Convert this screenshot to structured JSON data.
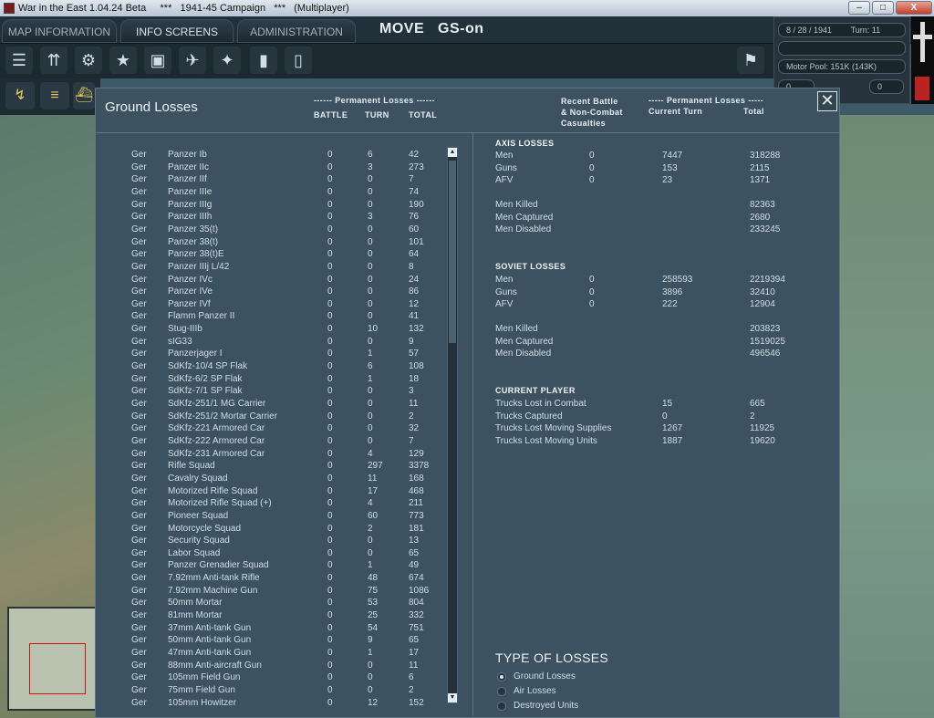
{
  "window": {
    "title": "War in the East 1.04.24 Beta     ***   1941-45 Campaign   ***   (Multiplayer)",
    "min": "–",
    "max": "□",
    "close": "X"
  },
  "topbar": {
    "tabs": [
      "MAP INFORMATION",
      "INFO SCREENS",
      "ADMINISTRATION"
    ],
    "mode": "MOVE",
    "gs": "GS-on"
  },
  "infopanel": {
    "date": "8 / 28 / 1941",
    "turn": "Turn: 11",
    "motor_pool": "Motor Pool: 151K (143K)",
    "counter_a": "0",
    "counter_b": "0"
  },
  "dialog": {
    "title": "Ground Losses",
    "left_header_group": "------ Permanent Losses ------",
    "col_battle": "BATTLE",
    "col_turn": "TURN",
    "col_total": "TOTAL",
    "right_header_1": "Recent Battle\n& Non-Combat\nCasualties",
    "right_header_group": "----- Permanent Losses -----",
    "right_col_turn": "Current Turn",
    "right_col_total": "Total",
    "close": "✕"
  },
  "units": [
    {
      "nat": "Ger",
      "name": "Panzer Ib",
      "battle": "0",
      "turn": "6",
      "total": "42"
    },
    {
      "nat": "Ger",
      "name": "Panzer IIc",
      "battle": "0",
      "turn": "3",
      "total": "273"
    },
    {
      "nat": "Ger",
      "name": "Panzer IIf",
      "battle": "0",
      "turn": "0",
      "total": "7"
    },
    {
      "nat": "Ger",
      "name": "Panzer IIIe",
      "battle": "0",
      "turn": "0",
      "total": "74"
    },
    {
      "nat": "Ger",
      "name": "Panzer IIIg",
      "battle": "0",
      "turn": "0",
      "total": "190"
    },
    {
      "nat": "Ger",
      "name": "Panzer IIIh",
      "battle": "0",
      "turn": "3",
      "total": "76"
    },
    {
      "nat": "Ger",
      "name": "Panzer 35(t)",
      "battle": "0",
      "turn": "0",
      "total": "60"
    },
    {
      "nat": "Ger",
      "name": "Panzer 38(t)",
      "battle": "0",
      "turn": "0",
      "total": "101"
    },
    {
      "nat": "Ger",
      "name": "Panzer 38(t)E",
      "battle": "0",
      "turn": "0",
      "total": "64"
    },
    {
      "nat": "Ger",
      "name": "Panzer IIIj L/42",
      "battle": "0",
      "turn": "0",
      "total": "8"
    },
    {
      "nat": "Ger",
      "name": "Panzer IVc",
      "battle": "0",
      "turn": "0",
      "total": "24"
    },
    {
      "nat": "Ger",
      "name": "Panzer IVe",
      "battle": "0",
      "turn": "0",
      "total": "86"
    },
    {
      "nat": "Ger",
      "name": "Panzer IVf",
      "battle": "0",
      "turn": "0",
      "total": "12"
    },
    {
      "nat": "Ger",
      "name": "Flamm Panzer II",
      "battle": "0",
      "turn": "0",
      "total": "41"
    },
    {
      "nat": "Ger",
      "name": "Stug-IIIb",
      "battle": "0",
      "turn": "10",
      "total": "132"
    },
    {
      "nat": "Ger",
      "name": "sIG33",
      "battle": "0",
      "turn": "0",
      "total": "9"
    },
    {
      "nat": "Ger",
      "name": "Panzerjager I",
      "battle": "0",
      "turn": "1",
      "total": "57"
    },
    {
      "nat": "Ger",
      "name": "SdKfz-10/4 SP Flak",
      "battle": "0",
      "turn": "6",
      "total": "108"
    },
    {
      "nat": "Ger",
      "name": "SdKfz-6/2 SP Flak",
      "battle": "0",
      "turn": "1",
      "total": "18"
    },
    {
      "nat": "Ger",
      "name": "SdKfz-7/1 SP Flak",
      "battle": "0",
      "turn": "0",
      "total": "3"
    },
    {
      "nat": "Ger",
      "name": "SdKfz-251/1 MG Carrier",
      "battle": "0",
      "turn": "0",
      "total": "11"
    },
    {
      "nat": "Ger",
      "name": "SdKfz-251/2 Mortar Carrier",
      "battle": "0",
      "turn": "0",
      "total": "2"
    },
    {
      "nat": "Ger",
      "name": "SdKfz-221 Armored Car",
      "battle": "0",
      "turn": "0",
      "total": "32"
    },
    {
      "nat": "Ger",
      "name": "SdKfz-222 Armored Car",
      "battle": "0",
      "turn": "0",
      "total": "7"
    },
    {
      "nat": "Ger",
      "name": "SdKfz-231 Armored Car",
      "battle": "0",
      "turn": "4",
      "total": "129"
    },
    {
      "nat": "Ger",
      "name": "Rifle Squad",
      "battle": "0",
      "turn": "297",
      "total": "3378"
    },
    {
      "nat": "Ger",
      "name": "Cavalry Squad",
      "battle": "0",
      "turn": "11",
      "total": "168"
    },
    {
      "nat": "Ger",
      "name": "Motorized Rifle Squad",
      "battle": "0",
      "turn": "17",
      "total": "468"
    },
    {
      "nat": "Ger",
      "name": "Motorized Rifle Squad (+)",
      "battle": "0",
      "turn": "4",
      "total": "211"
    },
    {
      "nat": "Ger",
      "name": "Pioneer Squad",
      "battle": "0",
      "turn": "60",
      "total": "773"
    },
    {
      "nat": "Ger",
      "name": "Motorcycle Squad",
      "battle": "0",
      "turn": "2",
      "total": "181"
    },
    {
      "nat": "Ger",
      "name": "Security Squad",
      "battle": "0",
      "turn": "0",
      "total": "13"
    },
    {
      "nat": "Ger",
      "name": "Labor Squad",
      "battle": "0",
      "turn": "0",
      "total": "65"
    },
    {
      "nat": "Ger",
      "name": "Panzer Grenadier Squad",
      "battle": "0",
      "turn": "1",
      "total": "49"
    },
    {
      "nat": "Ger",
      "name": "7.92mm Anti-tank Rifle",
      "battle": "0",
      "turn": "48",
      "total": "674"
    },
    {
      "nat": "Ger",
      "name": "7.92mm Machine Gun",
      "battle": "0",
      "turn": "75",
      "total": "1086"
    },
    {
      "nat": "Ger",
      "name": "50mm Mortar",
      "battle": "0",
      "turn": "53",
      "total": "804"
    },
    {
      "nat": "Ger",
      "name": "81mm Mortar",
      "battle": "0",
      "turn": "25",
      "total": "332"
    },
    {
      "nat": "Ger",
      "name": "37mm Anti-tank Gun",
      "battle": "0",
      "turn": "54",
      "total": "751"
    },
    {
      "nat": "Ger",
      "name": "50mm Anti-tank Gun",
      "battle": "0",
      "turn": "9",
      "total": "65"
    },
    {
      "nat": "Ger",
      "name": "47mm Anti-tank Gun",
      "battle": "0",
      "turn": "1",
      "total": "17"
    },
    {
      "nat": "Ger",
      "name": "88mm Anti-aircraft Gun",
      "battle": "0",
      "turn": "0",
      "total": "11"
    },
    {
      "nat": "Ger",
      "name": "105mm Field Gun",
      "battle": "0",
      "turn": "0",
      "total": "6"
    },
    {
      "nat": "Ger",
      "name": "75mm Field Gun",
      "battle": "0",
      "turn": "0",
      "total": "2"
    },
    {
      "nat": "Ger",
      "name": "105mm Howitzer",
      "battle": "0",
      "turn": "12",
      "total": "152"
    }
  ],
  "axis": {
    "title": "AXIS LOSSES",
    "rows": [
      {
        "label": "Men",
        "battle": "0",
        "turn": "7447",
        "total": "318288"
      },
      {
        "label": "Guns",
        "battle": "0",
        "turn": "153",
        "total": "2115"
      },
      {
        "label": "AFV",
        "battle": "0",
        "turn": "23",
        "total": "1371"
      }
    ],
    "detail": [
      {
        "label": "Men Killed",
        "battle": "",
        "turn": "",
        "total": "82363"
      },
      {
        "label": "Men Captured",
        "battle": "",
        "turn": "",
        "total": "2680"
      },
      {
        "label": "Men Disabled",
        "battle": "",
        "turn": "",
        "total": "233245"
      }
    ]
  },
  "soviet": {
    "title": "SOVIET LOSSES",
    "rows": [
      {
        "label": "Men",
        "battle": "0",
        "turn": "258593",
        "total": "2219394"
      },
      {
        "label": "Guns",
        "battle": "0",
        "turn": "3896",
        "total": "32410"
      },
      {
        "label": "AFV",
        "battle": "0",
        "turn": "222",
        "total": "12904"
      }
    ],
    "detail": [
      {
        "label": "Men Killed",
        "battle": "",
        "turn": "",
        "total": "203823"
      },
      {
        "label": "Men Captured",
        "battle": "",
        "turn": "",
        "total": "1519025"
      },
      {
        "label": "Men Disabled",
        "battle": "",
        "turn": "",
        "total": "496546"
      }
    ]
  },
  "player": {
    "title": "CURRENT PLAYER",
    "rows": [
      {
        "label": "Trucks Lost in Combat",
        "battle": "",
        "turn": "15",
        "total": "665"
      },
      {
        "label": "Trucks Captured",
        "battle": "",
        "turn": "0",
        "total": "2"
      },
      {
        "label": "Trucks Lost Moving Supplies",
        "battle": "",
        "turn": "1267",
        "total": "11925"
      },
      {
        "label": "Trucks Lost Moving Units",
        "battle": "",
        "turn": "1887",
        "total": "19620"
      }
    ]
  },
  "type_of_losses": {
    "title": "TYPE OF LOSSES",
    "options": [
      "Ground Losses",
      "Air Losses",
      "Destroyed Units"
    ],
    "selected": "Ground Losses"
  },
  "scroll": {
    "up": "▲",
    "down": "▼"
  }
}
